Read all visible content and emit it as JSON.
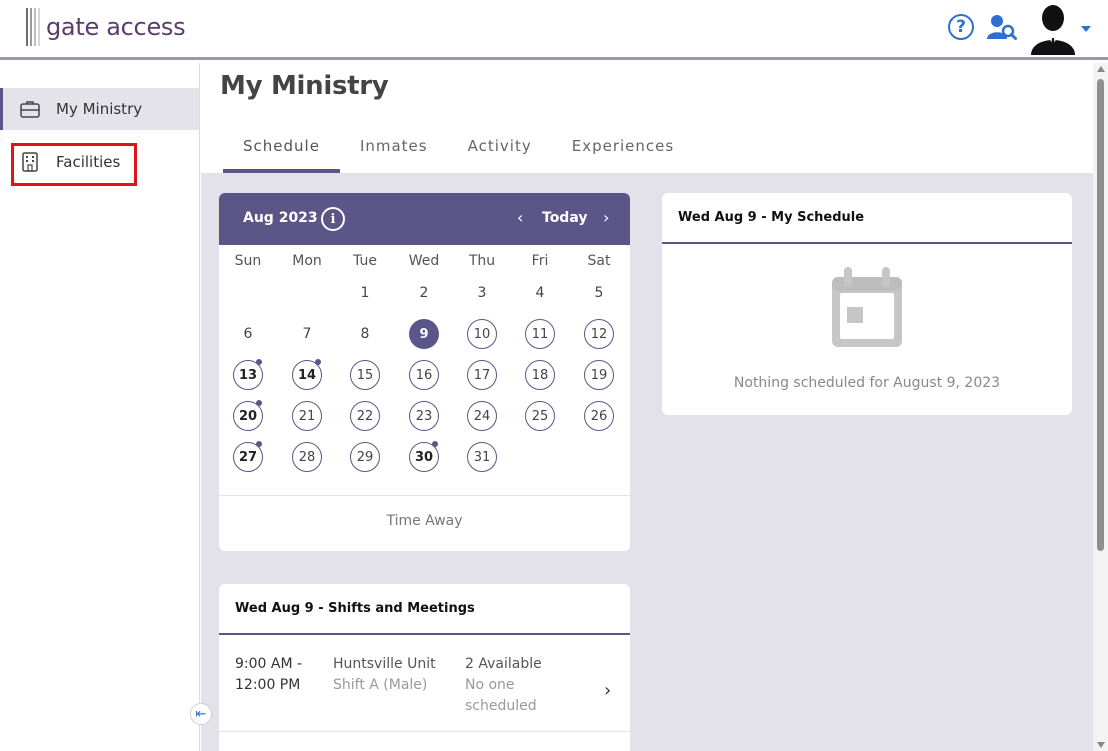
{
  "header": {
    "logo_text": "gate access",
    "help_icon": "help-circle-icon",
    "search_user_icon": "user-search-icon",
    "avatar_icon": "user-avatar-icon"
  },
  "sidebar": {
    "items": [
      {
        "label": "My Ministry",
        "icon": "briefcase-icon",
        "active": true
      },
      {
        "label": "Facilities",
        "icon": "building-icon",
        "active": false
      }
    ],
    "collapse_icon": "collapse-left-icon"
  },
  "main": {
    "title": "My Ministry",
    "tabs": [
      {
        "label": "Schedule",
        "active": true
      },
      {
        "label": "Inmates",
        "active": false
      },
      {
        "label": "Activity",
        "active": false
      },
      {
        "label": "Experiences",
        "active": false
      }
    ]
  },
  "calendar": {
    "month_label": "Aug 2023",
    "today_label": "Today",
    "prev_glyph": "‹",
    "next_glyph": "›",
    "info_glyph": "i",
    "weekdays": [
      "Sun",
      "Mon",
      "Tue",
      "Wed",
      "Thu",
      "Fri",
      "Sat"
    ],
    "selected_day": 9,
    "days_with_events": [
      13,
      14,
      20,
      27,
      30
    ],
    "time_away_label": "Time Away"
  },
  "my_schedule": {
    "title": "Wed Aug 9 - My Schedule",
    "empty_text": "Nothing scheduled for August 9, 2023"
  },
  "shifts": {
    "title": "Wed Aug 9 - Shifts and Meetings",
    "rows": [
      {
        "time_start": "9:00 AM -",
        "time_end": "12:00 PM",
        "place": "Huntsville Unit",
        "shift": "Shift A (Male)",
        "available": "2 Available",
        "status": "No one scheduled"
      }
    ]
  },
  "colors": {
    "accent": "#5c5587",
    "highlight_box": "#e0121b",
    "link_blue": "#2f6fd1",
    "main_bg": "#e3e2ea"
  }
}
